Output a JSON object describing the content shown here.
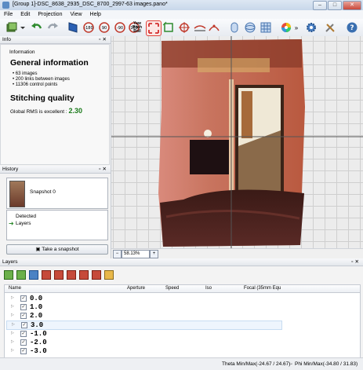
{
  "window": {
    "title": "[Group 1]-DSC_8638_2935_DSC_8700_2997-63 images.pano*"
  },
  "menu": [
    "File",
    "Edit",
    "Projection",
    "View",
    "Help"
  ],
  "toolbar": {
    "pitch_roll_label_1": "Yaw",
    "pitch_roll_label_2": "Pitch",
    "pitch_roll_label_3": "Roll",
    "rot_neg180": "-180",
    "rot_90": "90",
    "rot_neg90": "-90",
    "rot_180": "180"
  },
  "info": {
    "panel_title": "Info",
    "section_label": "Information",
    "heading": "General information",
    "bullets": [
      "63 images",
      "200 links between images",
      "11306 control points"
    ],
    "quality_heading": "Stitching quality",
    "rms_text": "Global RMS is excellent :",
    "rms_value": "2.30"
  },
  "history": {
    "panel_title": "History",
    "snapshot_label": "Snapshot 0",
    "detected_label": "Detected",
    "layers_label": "Layers",
    "take_snapshot": "Take a snapshot"
  },
  "zoom": {
    "value": "58.13%"
  },
  "layers": {
    "panel_title": "Layers",
    "columns": [
      "Name",
      "Aperture",
      "Speed",
      "Iso",
      "Focal (35mm Equ"
    ],
    "rows": [
      "0.0",
      "1.0",
      "2.0",
      "3.0",
      "-1.0",
      "-2.0",
      "-3.0"
    ]
  },
  "status": {
    "theta": "Theta Min/Max(-24.67 / 24.67)",
    "phi": "Phi Min/Max(-34.80 / 31.83)"
  },
  "colors": {
    "rms_good": "#1a7a1a",
    "accent": "#3a6fb0"
  }
}
